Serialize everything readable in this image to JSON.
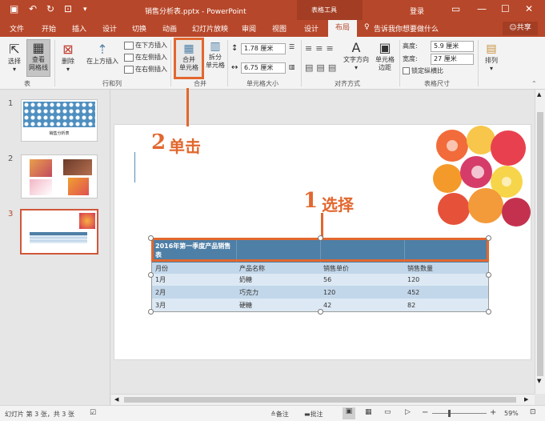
{
  "window": {
    "title": "销售分析表.pptx - PowerPoint",
    "context_tab_group": "表格工具",
    "signin": "登录",
    "share": "共享",
    "tell_me": "告诉我你想要做什么"
  },
  "tabs": [
    "文件",
    "开始",
    "插入",
    "设计",
    "切换",
    "动画",
    "幻灯片放映",
    "审阅",
    "视图",
    "设计",
    "布局"
  ],
  "ribbon": {
    "select": "选择",
    "view_gridlines_1": "查看",
    "view_gridlines_2": "网格线",
    "delete": "删除",
    "insert_above": "在上方插入",
    "insert_below": "在下方插入",
    "insert_left": "在左侧插入",
    "insert_right": "在右侧插入",
    "merge_1": "合并",
    "merge_2": "单元格",
    "split_1": "拆分",
    "split_2": "单元格",
    "height_val": "1.78 厘米",
    "width_val": "6.75 厘米",
    "text_direction": "文字方向",
    "cell_margins_1": "单元格",
    "cell_margins_2": "边距",
    "tbl_height_label": "高度:",
    "tbl_height_val": "5.9 厘米",
    "tbl_width_label": "宽度:",
    "tbl_width_val": "27 厘米",
    "lock_ratio": "锁定纵横比",
    "arrange": "排列",
    "groups": {
      "table": "表",
      "rows_cols": "行和列",
      "merge": "合并",
      "cell_size": "单元格大小",
      "alignment": "对齐方式",
      "table_size": "表格尺寸"
    }
  },
  "thumbnails": [
    {
      "num": "1",
      "caption": "销售分析表"
    },
    {
      "num": "2"
    },
    {
      "num": "3"
    }
  ],
  "callouts": {
    "step1_num": "1",
    "step1_text": "选择",
    "step2_num": "2",
    "step2_text": "单击"
  },
  "table": {
    "title": "2016年第一季度产品销售表",
    "headers": [
      "月份",
      "产品名称",
      "销售单价",
      "销售数量"
    ],
    "rows": [
      [
        "1月",
        "奶糖",
        "56",
        "120"
      ],
      [
        "2月",
        "巧克力",
        "120",
        "452"
      ],
      [
        "3月",
        "硬糖",
        "42",
        "82"
      ]
    ]
  },
  "status": {
    "slide_info": "幻灯片 第 3 张，共 3 张",
    "notes": "备注",
    "comments": "批注",
    "zoom": "59%"
  },
  "colors": {
    "accent": "#b7472a",
    "callout": "#e2672e",
    "table_header": "#4e7fa6",
    "row_light": "#dce9f4",
    "row_mid": "#c3d7ea"
  }
}
